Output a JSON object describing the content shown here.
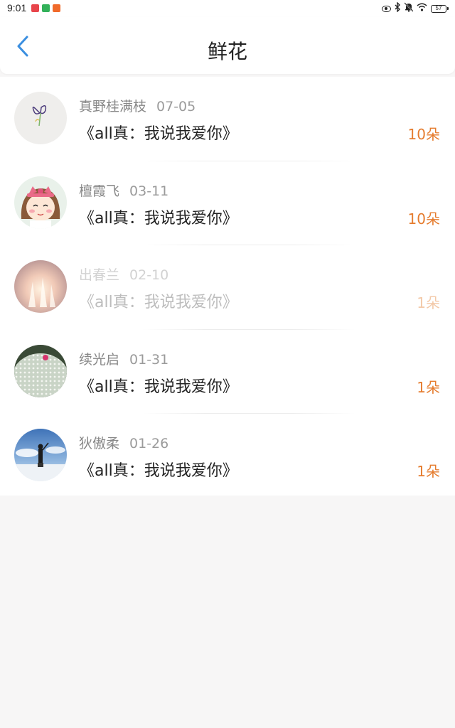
{
  "status_bar": {
    "time": "9:01",
    "battery": "57",
    "icons": [
      "app-red-icon",
      "app-green-icon",
      "app-orange-icon",
      "eye-icon",
      "bluetooth-icon",
      "mute-bell-icon",
      "wifi-icon",
      "battery-icon"
    ]
  },
  "header": {
    "title": "鲜花",
    "back_icon": "chevron-left-icon",
    "accent_color": "#3b8fe0"
  },
  "list": {
    "items": [
      {
        "name": "真野桂满枝",
        "date": "07-05",
        "message": "《all真：我说我爱你》",
        "count": "10朵",
        "avatar": "butterfly-drawing-avatar",
        "faded": false
      },
      {
        "name": "檀霞飞",
        "date": "03-11",
        "message": "《all真：我说我爱你》",
        "count": "10朵",
        "avatar": "cartoon-girl-avatar",
        "faded": false
      },
      {
        "name": "出春兰",
        "date": "02-10",
        "message": "《all真：我说我爱你》",
        "count": "1朵",
        "avatar": "fireworks-avatar",
        "faded": true
      },
      {
        "name": "续光启",
        "date": "01-31",
        "message": "《all真：我说我爱你》",
        "count": "1朵",
        "avatar": "cactus-avatar",
        "faded": false
      },
      {
        "name": "狄傲柔",
        "date": "01-26",
        "message": "《all真：我说我爱你》",
        "count": "1朵",
        "avatar": "sky-person-avatar",
        "faded": false
      }
    ]
  },
  "colors": {
    "count_orange": "#e57c2e",
    "background": "#f7f6f6"
  }
}
